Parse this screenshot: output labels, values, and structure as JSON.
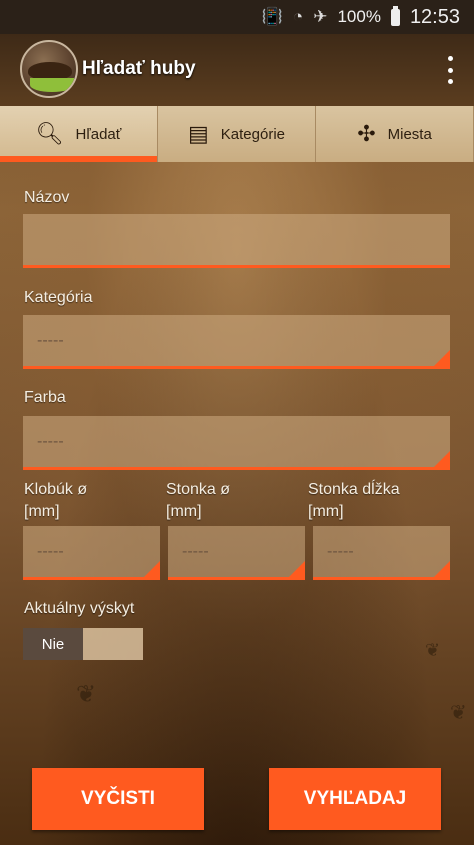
{
  "status_bar": {
    "battery": "100%",
    "time": "12:53",
    "icons": [
      "vibrate-icon",
      "wifi-icon",
      "airplane-mode-icon",
      "battery-icon"
    ]
  },
  "app_bar": {
    "title": "Hľadať huby",
    "logo": "mushroom-logo",
    "menu_icon": "overflow-menu-icon"
  },
  "tabs": [
    {
      "label": "Hľadať",
      "icon": "search-icon",
      "active": true
    },
    {
      "label": "Kategórie",
      "icon": "notebook-icon",
      "active": false
    },
    {
      "label": "Miesta",
      "icon": "map-compass-icon",
      "active": false
    }
  ],
  "form": {
    "name_label": "Názov",
    "name_value": "",
    "category_label": "Kategória",
    "category_value": "-----",
    "color_label": "Farba",
    "color_value": "-----",
    "cap_label_line1": "Klobúk ø",
    "cap_label_line2": "[mm]",
    "cap_value": "-----",
    "stem_label_line1": "Stonka ø",
    "stem_label_line2": "[mm]",
    "stem_value": "-----",
    "stem_length_label_line1": "Stonka dĺžka",
    "stem_length_label_line2": "[mm]",
    "stem_length_value": "-----",
    "current_label": "Aktuálny výskyt",
    "current_toggle": "Nie"
  },
  "buttons": {
    "clear": "VYČISTI",
    "search": "VYHĽADAJ"
  },
  "colors": {
    "accent": "#ff5a1f",
    "status_bar": "#2b2118",
    "text_light": "#f5eee2"
  }
}
